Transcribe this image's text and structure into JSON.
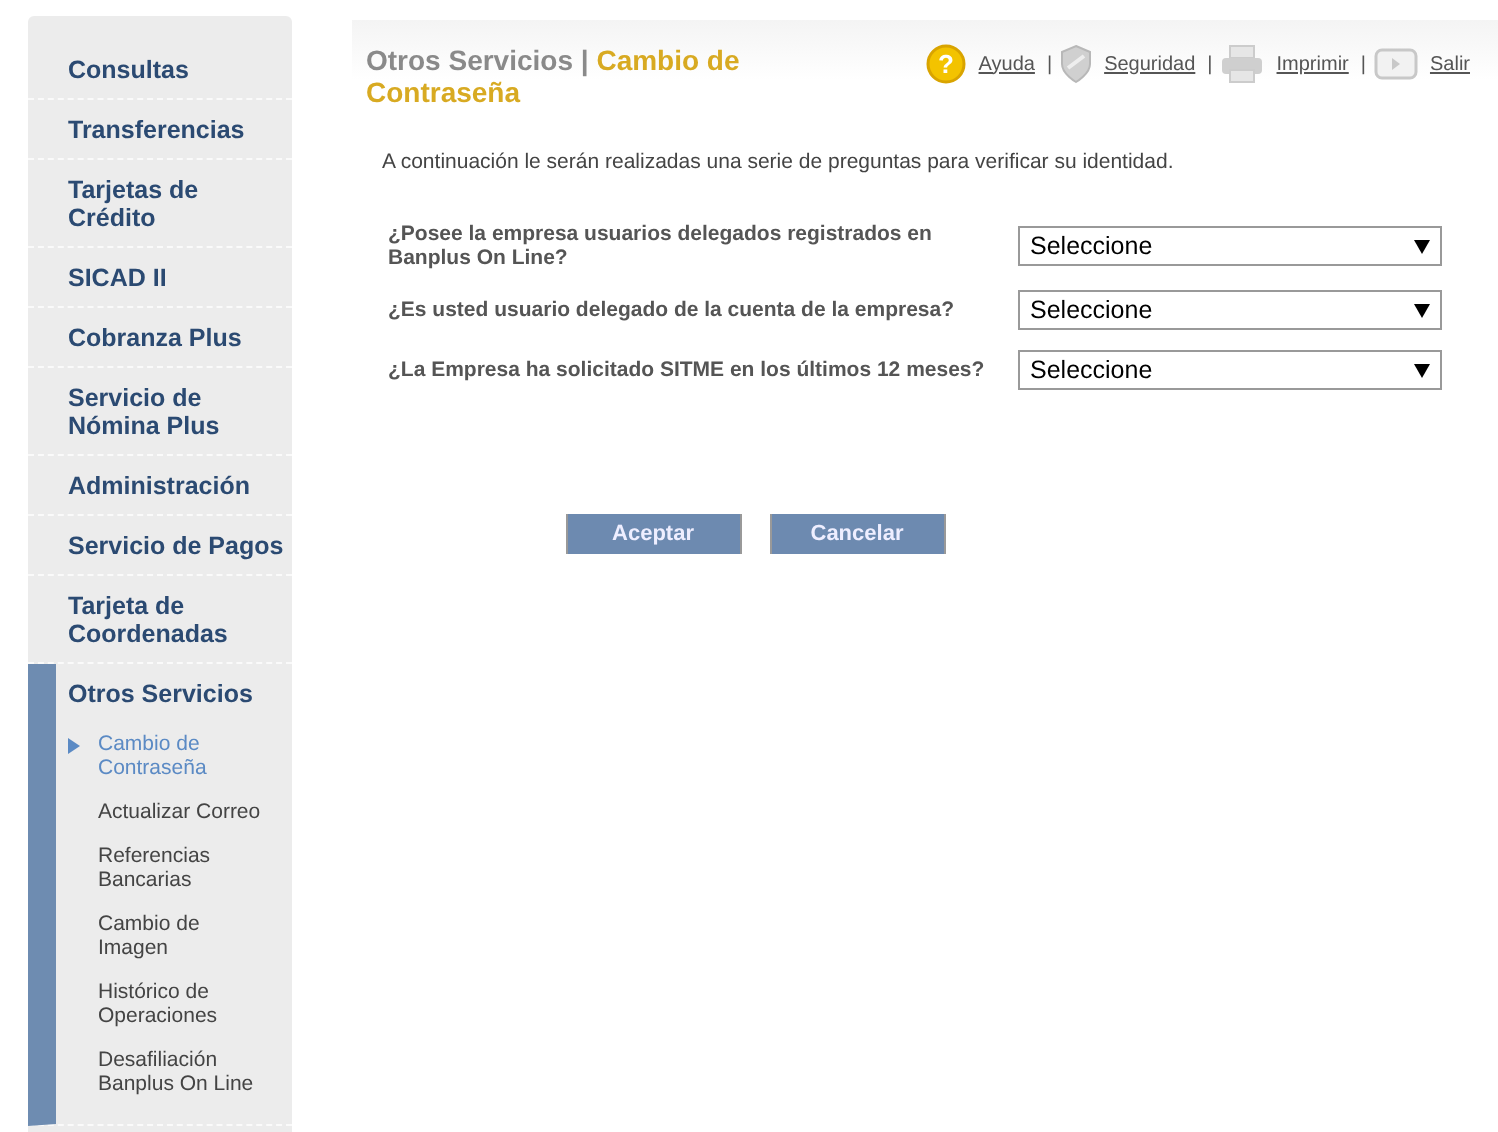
{
  "sidebar": {
    "items": [
      {
        "label": "Consultas",
        "expanded": false
      },
      {
        "label": "Transferencias",
        "expanded": false
      },
      {
        "label": "Tarjetas de Crédito",
        "expanded": false
      },
      {
        "label": "SICAD II",
        "expanded": false
      },
      {
        "label": "Cobranza Plus",
        "expanded": false
      },
      {
        "label": "Servicio de Nómina Plus",
        "expanded": false
      },
      {
        "label": "Administración",
        "expanded": false
      },
      {
        "label": "Servicio de Pagos",
        "expanded": false
      },
      {
        "label": "Tarjeta de Coordenadas",
        "expanded": false
      },
      {
        "label": "Otros Servicios",
        "expanded": true,
        "children": [
          {
            "label": "Cambio de Contraseña",
            "selected": true
          },
          {
            "label": "Actualizar Correo",
            "selected": false
          },
          {
            "label": "Referencias Bancarias",
            "selected": false
          },
          {
            "label": "Cambio de Imagen",
            "selected": false
          },
          {
            "label": "Histórico de Operaciones",
            "selected": false
          },
          {
            "label": "Desafiliación Banplus On Line",
            "selected": false
          }
        ]
      }
    ]
  },
  "header": {
    "section": "Otros Servicios",
    "separator": "|",
    "page": "Cambio de Contraseña",
    "links": [
      {
        "kind": "help",
        "glyph": "?",
        "label": "Ayuda",
        "separator": "|"
      },
      {
        "kind": "security",
        "label": "Seguridad",
        "separator": "|"
      },
      {
        "kind": "print",
        "label": "Imprimir",
        "separator": "|"
      },
      {
        "kind": "exit",
        "label": "Salir"
      }
    ]
  },
  "intro": "A continuación le serán realizadas una serie de preguntas para verificar su identidad.",
  "questions": [
    {
      "label": "¿Posee la empresa usuarios delegados registrados en Banplus On Line?",
      "value": "Seleccione"
    },
    {
      "label": "¿Es usted usuario delegado de la cuenta de la empresa?",
      "value": "Seleccione"
    },
    {
      "label": "¿La Empresa ha solicitado SITME en los últimos 12 meses?",
      "value": "Seleccione"
    }
  ],
  "buttons": [
    "Aceptar",
    "Cancelar"
  ]
}
